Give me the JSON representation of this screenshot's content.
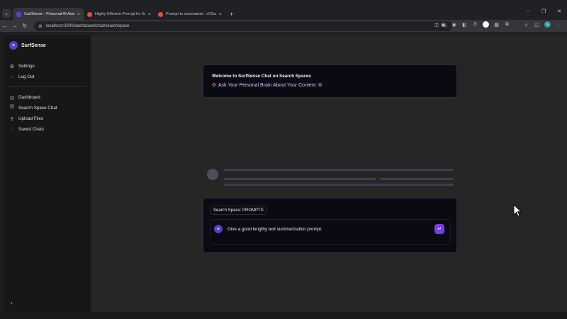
{
  "browser": {
    "tabs": [
      {
        "title": "SurfSense - Personal AI Assistant",
        "active": true,
        "favicon_color": "#5b3fc4"
      },
      {
        "title": "Highly Efficient Prompt for Summarization",
        "active": false,
        "favicon_color": "#e0523b"
      },
      {
        "title": "Prompt to summarize : r/ChatGPT",
        "active": false,
        "favicon_color": "#e0523b"
      }
    ],
    "url": "localhost:3000/dashboard/chat/searchspace",
    "profile_letter": "G"
  },
  "sidebar": {
    "brand": "SurfSense",
    "logo_text": "SurfSense",
    "top_items": [
      {
        "label": "Settings",
        "icon": "gear-icon"
      },
      {
        "label": "Log Out",
        "icon": "arrow-left-icon"
      }
    ],
    "main_items": [
      {
        "label": "Dashboard",
        "icon": "gauge-icon"
      },
      {
        "label": "Search Space Chat",
        "icon": "file-search-icon"
      },
      {
        "label": "Upload Files",
        "icon": "upload-icon"
      },
      {
        "label": "Saved Chats",
        "icon": "chat-search-icon"
      }
    ]
  },
  "welcome": {
    "title": "Welcome to SurfSense Chat on Search Spaces",
    "subtitle": "Ask Your Personal Brain About Your Content"
  },
  "chat": {
    "search_space_label": "Search Space: PROMPTS",
    "message": "Give a good lengthy text summarization prompt.",
    "send_icon": "enter-icon"
  },
  "colors": {
    "accent": "#7c3aed",
    "logo": "#5b3fc4",
    "card_bg": "#0a0a12"
  }
}
